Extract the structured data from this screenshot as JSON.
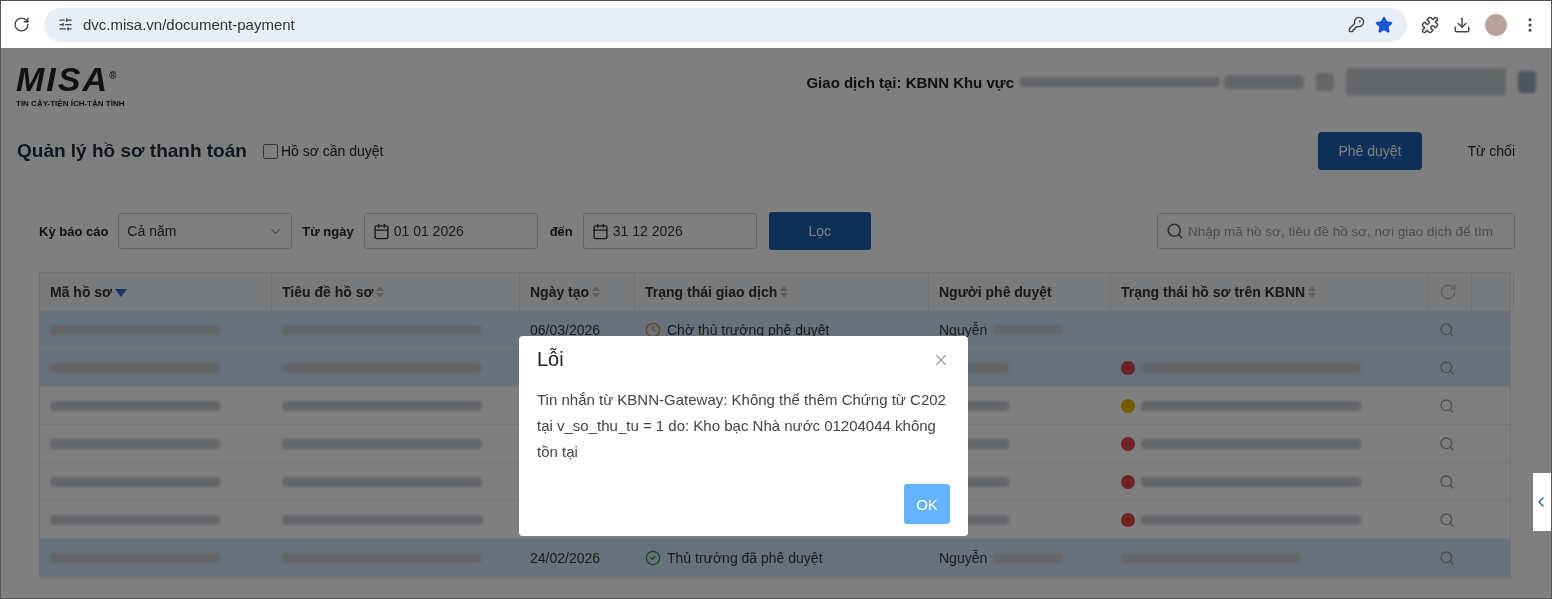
{
  "browser": {
    "url": "dvc.misa.vn/document-payment"
  },
  "header": {
    "logo": "MISA",
    "logo_mark": "®",
    "tagline": "TIN CẬY-TIỆN ÍCH-TẬN TÌNH",
    "location_label": "Giao dịch tại: KBNN Khu vực"
  },
  "page": {
    "title": "Quản lý hồ sơ thanh toán",
    "filter_checkbox": {
      "label": "Hồ sơ cần duyệt",
      "checked": false
    },
    "buttons": [
      {
        "label": "Phê duyệt",
        "kind": "primary"
      },
      {
        "label": "Từ chối",
        "kind": "plain"
      }
    ]
  },
  "filters": {
    "period_label": "Kỳ báo cáo",
    "period_value": "Cả năm",
    "from_label": "Từ ngày",
    "from_value": "01 01 2026",
    "to_label": "đến",
    "to_value": "31 12 2026",
    "filter_button": "Lọc",
    "search_placeholder": "Nhập mã hồ sơ, tiêu đề hồ sơ, nơi giao dịch để tìm"
  },
  "table": {
    "columns": [
      {
        "label": "Mã hồ sơ",
        "sortable": true,
        "sorted": true
      },
      {
        "label": "Tiêu đề hồ sơ",
        "sortable": true,
        "sorted": false
      },
      {
        "label": "Ngày tạo",
        "sortable": true,
        "sorted": false
      },
      {
        "label": "Trạng thái giao dịch",
        "sortable": true,
        "sorted": false
      },
      {
        "label": "Người phê duyệt",
        "sortable": false
      },
      {
        "label": "Trạng thái hồ sơ trên KBNN",
        "sortable": true,
        "sorted": false
      }
    ],
    "rows": [
      {
        "selected": true,
        "date": "06/03/2026",
        "status": {
          "kind": "pending",
          "text": "Chờ thủ trưởng phê duyệt"
        },
        "approver": "Nguyễn"
      },
      {
        "selected": true,
        "kbnn": {
          "kind": "error"
        }
      },
      {
        "selected": false,
        "kbnn": {
          "kind": "warning"
        }
      },
      {
        "selected": false,
        "kbnn": {
          "kind": "error"
        }
      },
      {
        "selected": false,
        "kbnn": {
          "kind": "error"
        }
      },
      {
        "selected": false,
        "kbnn": {
          "kind": "error"
        }
      },
      {
        "selected": true,
        "date": "24/02/2026",
        "status": {
          "kind": "approved",
          "text": "Thủ trưởng đã phê duyệt"
        },
        "approver": "Nguyễn",
        "kbnn": {
          "kind": "plain"
        }
      }
    ]
  },
  "dialog": {
    "title": "Lỗi",
    "message": "Tin nhắn từ KBNN-Gateway: Không thể thêm Chứng từ C202 tại v_so_thu_tu = 1 do: Kho bạc Nhà nước 01204044 không tồn tại",
    "ok": "OK"
  }
}
